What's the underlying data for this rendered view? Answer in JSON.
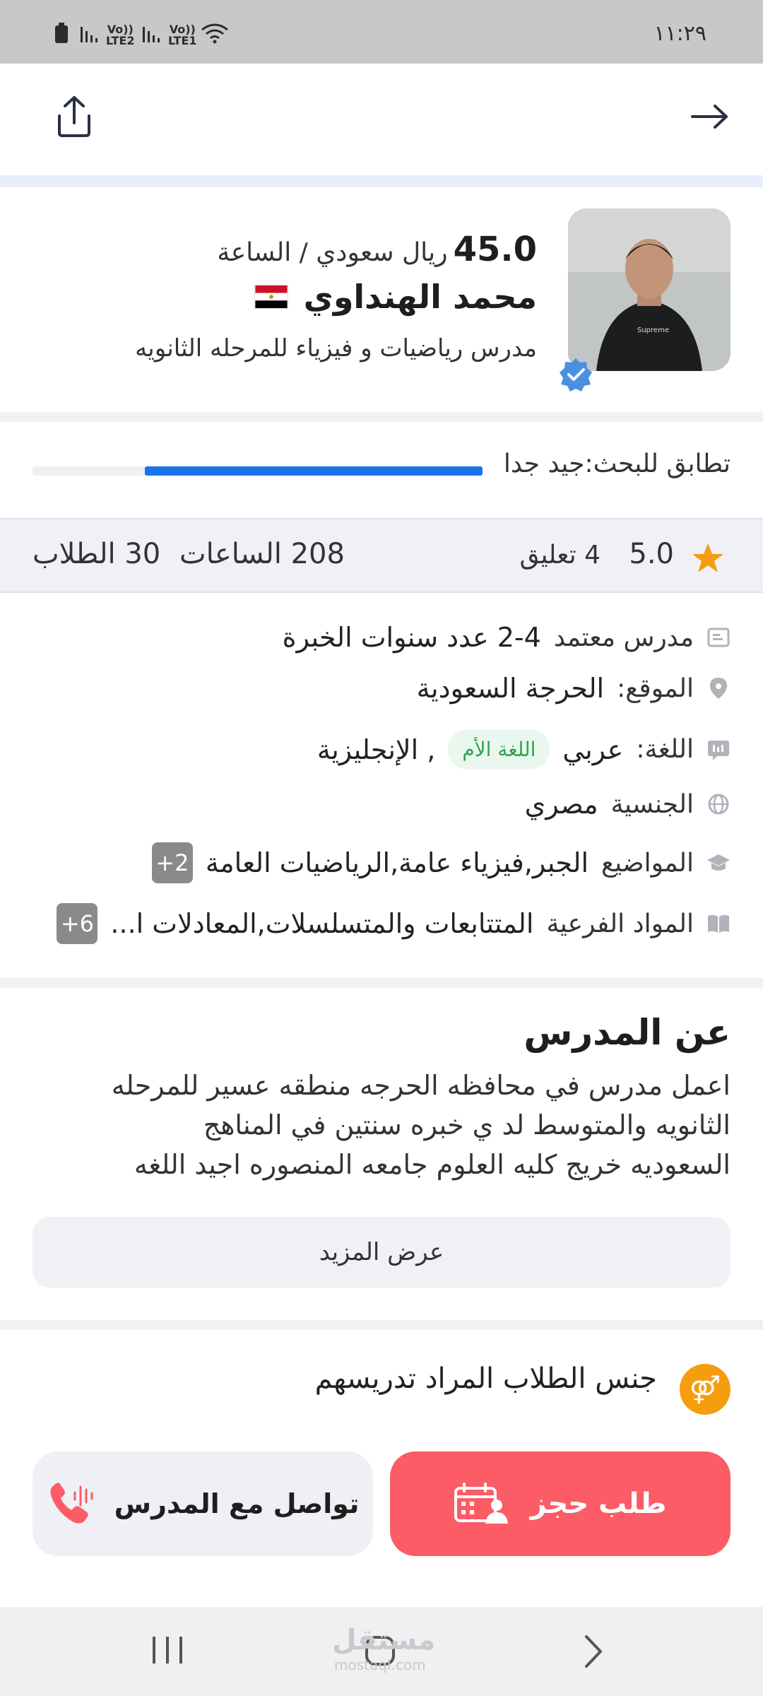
{
  "status_bar": {
    "time": "١١:٢٩",
    "sim1": "LTE1",
    "sim2": "LTE2",
    "volte": "Vo))"
  },
  "header": {
    "back_icon": "arrow-right-icon",
    "share_icon": "share-icon"
  },
  "profile": {
    "price": "45.0",
    "price_unit": "ريال سعودي / الساعة",
    "name": "محمد الهنداوي",
    "flag": "egypt-flag",
    "title": "مدرس رياضيات و فيزياء للمرحله الثانويه",
    "verified_icon": "verified-badge-icon"
  },
  "match": {
    "label": "تطابق للبحث:جيد جدا",
    "value": 0.75,
    "color": "#1a73e8"
  },
  "stats": {
    "rating": "5.0",
    "reviews": "4 تعليق",
    "hours": "208 الساعات",
    "students": "30 الطلاب"
  },
  "details": {
    "certified": {
      "label": "مدرس معتمد",
      "value": "2-4 عدد سنوات الخبرة"
    },
    "location": {
      "label": "الموقع:",
      "value": "الحرجة السعودية"
    },
    "language": {
      "label": "اللغة:",
      "value1": "عربي",
      "badge": "اللغة الأم",
      "value2": ", الإنجليزية"
    },
    "nationality": {
      "label": "الجنسية",
      "value": "مصري"
    },
    "subjects": {
      "label": "المواضيع",
      "value": "الجبر,فيزياء عامة,الرياضيات العامة",
      "more": "2+"
    },
    "sub_subjects": {
      "label": "المواد الفرعية",
      "value": "المتتابعات والمتسلسلات,المعادلات ا...",
      "more": "6+"
    }
  },
  "about": {
    "heading": "عن المدرس",
    "line1": "اعمل مدرس في محافظه الحرجه منطقه عسير  للمرحله",
    "line2": "الثانويه والمتوسط لد ي خبره سنتين في المناهج",
    "line3": "السعوديه خريج كليه العلوم جامعه المنصوره  اجيد اللغه",
    "show_more": "عرض المزيد"
  },
  "gender": {
    "label": "جنس الطلاب المراد تدريسهم"
  },
  "actions": {
    "book": "طلب حجز",
    "contact": "تواصل مع المدرس",
    "book_color": "#fb5c66"
  },
  "watermark": {
    "text": "مستقل",
    "sub": "mostaql.com"
  },
  "colors": {
    "accent_blue": "#1a73e8",
    "star": "#f59d0e",
    "book": "#fb5c66"
  }
}
